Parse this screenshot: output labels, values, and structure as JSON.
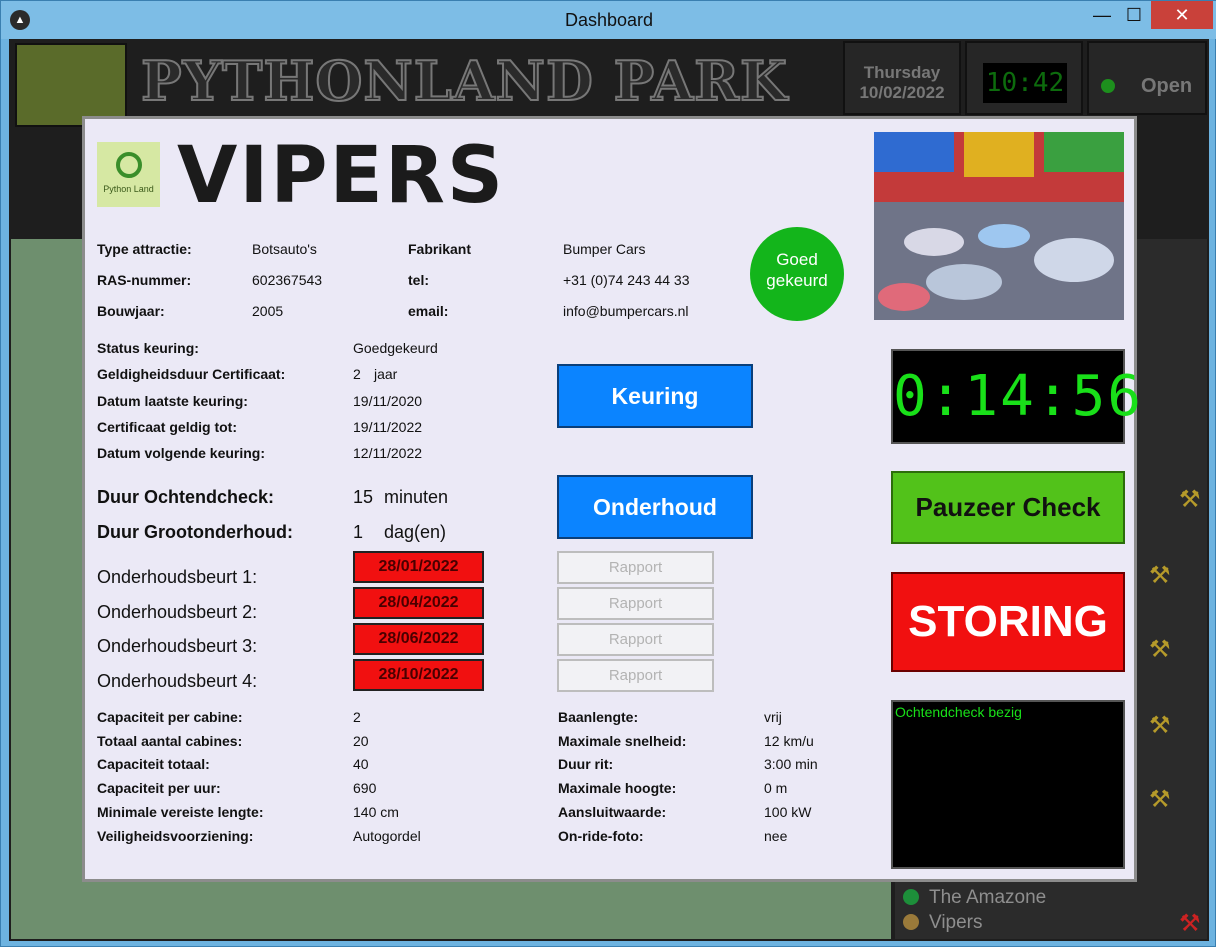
{
  "window": {
    "title": "Dashboard",
    "min": "—",
    "max": "☐",
    "close": "✕"
  },
  "dashboard": {
    "banner": "PYTHONLAND PARK ATTRACTIONS",
    "day": "Thursday",
    "date": "10/02/2022",
    "clock": "10:42",
    "open_status": "Open",
    "attractions": [
      {
        "name": "The Amazone",
        "dot_color": "#1d8f3a"
      },
      {
        "name": "Vipers",
        "dot_color": "#9a7a3a"
      }
    ]
  },
  "modal": {
    "logo_text": "Python Land",
    "title": "VIPERS",
    "info": {
      "type_label": "Type attractie:",
      "type_value": "Botsauto's",
      "ras_label": "RAS-nummer:",
      "ras_value": "602367543",
      "bouwjaar_label": "Bouwjaar:",
      "bouwjaar_value": "2005",
      "fabrikant_label": "Fabrikant",
      "fabrikant_value": "Bumper Cars",
      "tel_label": "tel:",
      "tel_value": "+31 (0)74 243 44 33",
      "email_label": "email:",
      "email_value": "info@bumpercars.nl"
    },
    "badge": "Goed gekeurd",
    "keuring": {
      "status_label": "Status keuring:",
      "status_value": "Goedgekeurd",
      "geldigheid_label": "Geldigheidsduur Certificaat:",
      "geldigheid_num": "2",
      "geldigheid_unit": "jaar",
      "laatste_label": "Datum laatste keuring:",
      "laatste_value": "19/11/2020",
      "geldig_tot_label": "Certificaat geldig tot:",
      "geldig_tot_value": "19/11/2022",
      "volgende_label": "Datum volgende keuring:",
      "volgende_value": "12/11/2022"
    },
    "duur": {
      "ochtend_label": "Duur Ochtendcheck:",
      "ochtend_num": "15",
      "ochtend_unit": "minuten",
      "groot_label": "Duur Grootonderhoud:",
      "groot_num": "1",
      "groot_unit": "dag(en)"
    },
    "onderhoud": [
      {
        "label": "Onderhoudsbeurt 1:",
        "date": "28/01/2022",
        "report": "Rapport"
      },
      {
        "label": "Onderhoudsbeurt 2:",
        "date": "28/04/2022",
        "report": "Rapport"
      },
      {
        "label": "Onderhoudsbeurt 3:",
        "date": "28/06/2022",
        "report": "Rapport"
      },
      {
        "label": "Onderhoudsbeurt 4:",
        "date": "28/10/2022",
        "report": "Rapport"
      }
    ],
    "specs_left": [
      {
        "label": "Capaciteit per cabine:",
        "value": "2"
      },
      {
        "label": "Totaal aantal cabines:",
        "value": "20"
      },
      {
        "label": "Capaciteit totaal:",
        "value": "40"
      },
      {
        "label": "Capaciteit per uur:",
        "value": "690"
      },
      {
        "label": "Minimale vereiste lengte:",
        "value": "140 cm"
      },
      {
        "label": "Veiligheidsvoorziening:",
        "value": "Autogordel"
      }
    ],
    "specs_right": [
      {
        "label": "Baanlengte:",
        "value": "vrij"
      },
      {
        "label": "Maximale snelheid:",
        "value": "12 km/u"
      },
      {
        "label": "Duur rit:",
        "value": "3:00 min"
      },
      {
        "label": "Maximale hoogte:",
        "value": "0 m"
      },
      {
        "label": "Aansluitwaarde:",
        "value": "100 kW"
      },
      {
        "label": "On-ride-foto:",
        "value": "nee"
      }
    ],
    "buttons": {
      "keuring": "Keuring",
      "onderhoud": "Onderhoud",
      "pauzeer": "Pauzeer Check",
      "storing": "STORING"
    },
    "timer": "0:14:56",
    "log": "Ochtendcheck bezig"
  }
}
